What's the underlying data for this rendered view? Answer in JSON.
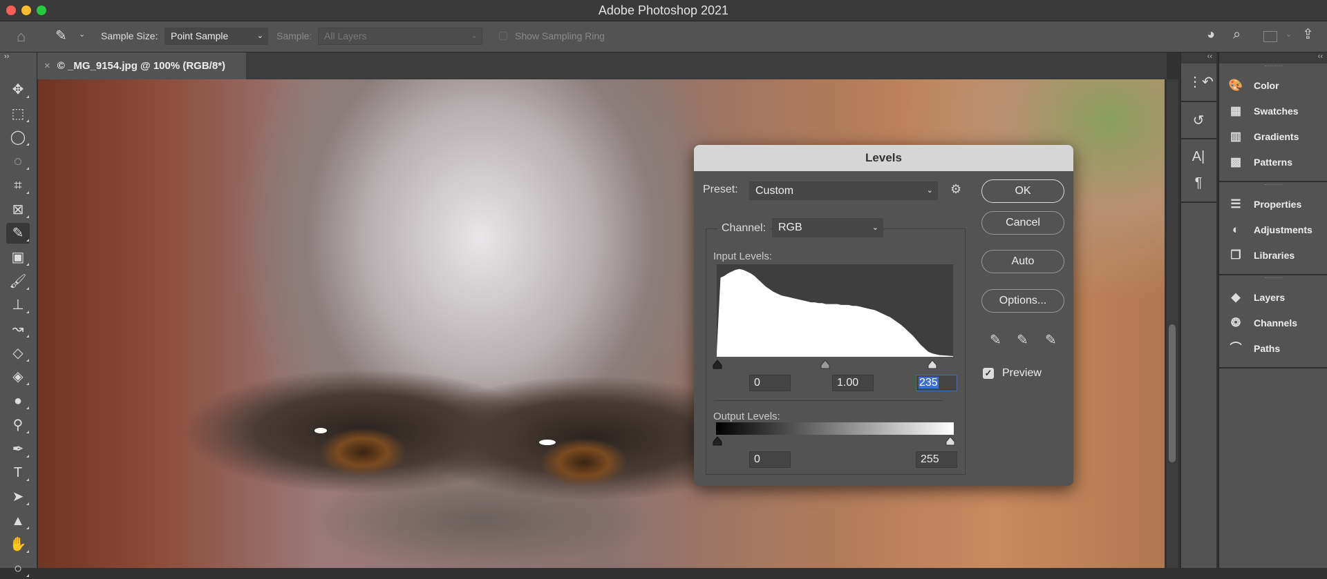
{
  "app": {
    "title": "Adobe Photoshop 2021"
  },
  "options_bar": {
    "sample_size_label": "Sample Size:",
    "sample_size_value": "Point Sample",
    "sample_label": "Sample:",
    "sample_value": "All Layers",
    "show_sampling_ring": "Show Sampling Ring",
    "show_sampling_ring_checked": false
  },
  "document_tab": {
    "title": "© _MG_9154.jpg @ 100% (RGB/8*)",
    "close": "×"
  },
  "tools": [
    "move",
    "marquee",
    "lasso",
    "quick-selection",
    "crop",
    "frame",
    "eyedropper",
    "patch",
    "brush",
    "stamp",
    "history-brush",
    "eraser",
    "paint-bucket",
    "blur",
    "dodge",
    "pen",
    "type",
    "path-selection",
    "shape",
    "hand",
    "zoom"
  ],
  "active_tool": "eyedropper",
  "panels": {
    "icon_column": [
      "history-states",
      "history",
      "character",
      "paragraph"
    ],
    "groups": [
      [
        {
          "label": "Color",
          "icon": "palette-icon"
        },
        {
          "label": "Swatches",
          "icon": "grid-icon"
        },
        {
          "label": "Gradients",
          "icon": "gradient-icon"
        },
        {
          "label": "Patterns",
          "icon": "pattern-icon"
        }
      ],
      [
        {
          "label": "Properties",
          "icon": "sliders-icon"
        },
        {
          "label": "Adjustments",
          "icon": "adjust-icon"
        },
        {
          "label": "Libraries",
          "icon": "library-icon"
        }
      ],
      [
        {
          "label": "Layers",
          "icon": "layers-icon"
        },
        {
          "label": "Channels",
          "icon": "channels-icon"
        },
        {
          "label": "Paths",
          "icon": "paths-icon"
        }
      ]
    ]
  },
  "levels_dialog": {
    "title": "Levels",
    "preset_label": "Preset:",
    "preset_value": "Custom",
    "channel_label": "Channel:",
    "channel_value": "RGB",
    "input_levels_label": "Input Levels:",
    "input_black": "0",
    "input_gamma": "1.00",
    "input_white": "235",
    "output_levels_label": "Output Levels:",
    "output_black": "0",
    "output_white": "255",
    "buttons": {
      "ok": "OK",
      "cancel": "Cancel",
      "auto": "Auto",
      "options": "Options..."
    },
    "preview_label": "Preview",
    "preview_checked": true,
    "histogram": [
      0.05,
      0.9,
      0.92,
      0.95,
      0.97,
      0.99,
      1.0,
      0.99,
      0.97,
      0.95,
      0.92,
      0.88,
      0.84,
      0.8,
      0.77,
      0.74,
      0.72,
      0.7,
      0.69,
      0.68,
      0.67,
      0.66,
      0.65,
      0.64,
      0.63,
      0.62,
      0.62,
      0.61,
      0.61,
      0.6,
      0.6,
      0.6,
      0.6,
      0.59,
      0.59,
      0.59,
      0.58,
      0.58,
      0.57,
      0.56,
      0.55,
      0.54,
      0.53,
      0.51,
      0.49,
      0.47,
      0.45,
      0.42,
      0.39,
      0.36,
      0.32,
      0.28,
      0.24,
      0.19,
      0.14,
      0.1,
      0.06,
      0.04,
      0.03,
      0.02
    ]
  }
}
